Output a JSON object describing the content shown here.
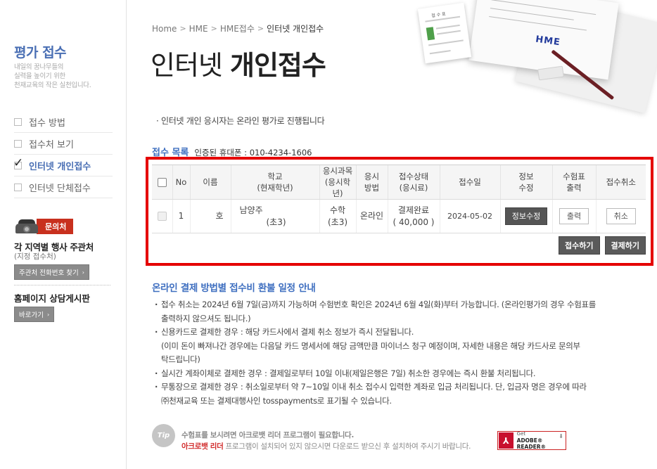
{
  "sidebar": {
    "title": "평가 접수",
    "desc_lines": [
      "내일의 꿈나무들의",
      "실력을 높이기 위한",
      "천재교육의 작은 실천입니다."
    ],
    "menu": [
      {
        "label": "접수 방법",
        "active": false
      },
      {
        "label": "접수처 보기",
        "active": false
      },
      {
        "label": "인터넷 개인접수",
        "active": true
      },
      {
        "label": "인터넷 단체접수",
        "active": false
      }
    ],
    "contact_badge": "문의처",
    "region_title": "각 지역별 행사 주관처",
    "region_sub": "(지정 접수처)",
    "region_button": "주관처 전화번호 찾기",
    "board_title": "홈페이지 상담게시판",
    "board_button": "바로가기"
  },
  "breadcrumb": [
    "Home",
    "HME",
    "HME접수",
    "인터넷 개인접수"
  ],
  "page_title": {
    "light": "인터넷",
    "bold": "개인접수"
  },
  "illustration": {
    "paper_header": "접 수 표",
    "stamp": "HME",
    "pencil_color": "#6b1f24"
  },
  "notice": "인터넷 개인 응시자는 온라인 평가로 진행됩니다",
  "list": {
    "title": "접수 목록",
    "phone": "인증된 휴대폰 : 010-4234-1606"
  },
  "table": {
    "headers": [
      {
        "line1": "No",
        "line2": ""
      },
      {
        "line1": "이름",
        "line2": ""
      },
      {
        "line1": "학교",
        "line2": "(현재학년)"
      },
      {
        "line1": "응시과목",
        "line2": "(응시학년)"
      },
      {
        "line1": "응시",
        "line2": "방법"
      },
      {
        "line1": "접수상태",
        "line2": "(응시료)"
      },
      {
        "line1": "접수일",
        "line2": ""
      },
      {
        "line1": "정보",
        "line2": "수정"
      },
      {
        "line1": "수험표",
        "line2": "출력"
      },
      {
        "line1": "접수취소",
        "line2": ""
      }
    ],
    "rows": [
      {
        "no": "1",
        "name": "호",
        "school": "남양주",
        "school_grade": "(초3)",
        "subject": "수학",
        "subject_grade": "(초3)",
        "method": "온라인",
        "status": "결제완료",
        "fee": "( 40,000 )",
        "date": "2024-05-02",
        "edit_label": "정보수정",
        "print_label": "출력",
        "cancel_label": "취소"
      }
    ]
  },
  "actions": {
    "apply": "접수하기",
    "pay": "결제하기"
  },
  "refund": {
    "title": "온라인 결제 방법별 접수비 환불 일정 안내",
    "items": [
      [
        "접수 취소는 2024년 6월 7일(금)까지 가능하며 수험번호 확인은 2024년 6월 4일(화)부터 가능합니다. (온라인평가의 경우 수험표를",
        "출력하지 않으셔도 됩니다.)"
      ],
      [
        "신용카드로 결제한 경우 : 해당 카드사에서 결제 취소 정보가 즉시 전달됩니다.",
        "(이미 돈이 빠져나간 경우에는 다음달 카드 명세서에 해당 금액만큼 마이너스 청구 예정이며, 자세한 내용은 해당 카드사로 문의부",
        "탁드립니다)"
      ],
      [
        "실시간 계좌이체로 결제한 경우 : 결제일로부터 10일 이내(제일은행은 7일) 취소한 경우에는 즉시 환불 처리됩니다."
      ],
      [
        "무통장으로 결제한 경우 : 취소일로부터 약 7~10일 이내 취소 접수시 입력한 계좌로 입금 처리됩니다. 단, 입금자 명은 경우에 따라",
        "㈜천재교육 또는 결제대행사인 tosspayments로 표기될 수 있습니다."
      ]
    ]
  },
  "tip": {
    "badge": "Tip",
    "line1": "수험표를 보시려면 아크로뱃 리더 프로그램이 필요합니다.",
    "line2_hl": "아크로뱃 리더",
    "line2_rest": " 프로그램이 설치되어 있지 않으시면 다운로드 받으신 후 설치하여 주시기 바랍니다.",
    "adobe_get": "Get",
    "adobe_name": "ADOBE® READER®"
  }
}
